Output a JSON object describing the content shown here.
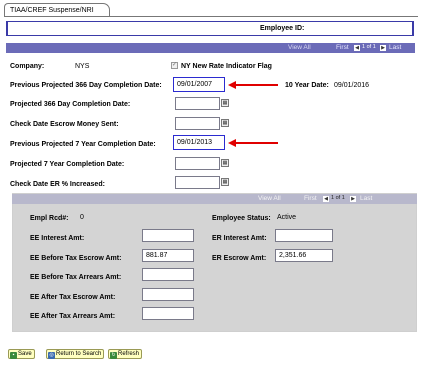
{
  "tab": {
    "label": "TIAA/CREF Suspense/NRI"
  },
  "employee": {
    "id_label": "Employee ID:"
  },
  "nav": {
    "view_all": "View All",
    "first": "First",
    "range": "1 of 1",
    "last": "Last"
  },
  "form": {
    "company_label": "Company:",
    "company_value": "NYS",
    "nri_flag_label": "NY New Rate Indicator Flag",
    "nri_flag_checked": true,
    "prev_366_label": "Previous Projected 366 Day Completion Date:",
    "prev_366_value": "09/01/2007",
    "ten_year_label": "10 Year Date:",
    "ten_year_value": "09/01/2016",
    "proj_366_label": "Projected 366 Day Completion Date:",
    "proj_366_value": "",
    "check_escrow_label": "Check Date Escrow Money Sent:",
    "check_escrow_value": "",
    "prev_7yr_label": "Previous Projected 7 Year Completion Date:",
    "prev_7yr_value": "09/01/2013",
    "proj_7yr_label": "Projected 7 Year Completion Date:",
    "proj_7yr_value": "",
    "check_er_label": "Check Date ER % Increased:",
    "check_er_value": ""
  },
  "detail": {
    "empl_rcd_label": "Empl Rcd#:",
    "empl_rcd_value": "0",
    "emp_status_label": "Employee Status:",
    "emp_status_value": "Active",
    "ee_interest_label": "EE Interest Amt:",
    "ee_interest_value": "",
    "er_interest_label": "ER Interest Amt:",
    "er_interest_value": "",
    "ee_before_escrow_label": "EE Before Tax Escrow Amt:",
    "ee_before_escrow_value": "881.87",
    "er_escrow_label": "ER Escrow Amt:",
    "er_escrow_value": "2,351.66",
    "ee_before_arrears_label": "EE Before Tax Arrears Amt:",
    "ee_before_arrears_value": "",
    "ee_after_escrow_label": "EE After Tax Escrow Amt:",
    "ee_after_escrow_value": "",
    "ee_after_arrears_label": "EE After Tax Arrears Amt:",
    "ee_after_arrears_value": ""
  },
  "buttons": {
    "save": "Save",
    "return": "Return to Search",
    "refresh": "Refresh"
  },
  "colors": {
    "nav_bar": "#6b6bb8",
    "annotation_arrow": "#e00000",
    "highlight_border": "#2b2bd0",
    "button_bg": "#ffffc0"
  },
  "icons": {
    "calendar": "calendar-icon",
    "prev": "previous-arrow-icon",
    "next": "next-arrow-icon"
  }
}
